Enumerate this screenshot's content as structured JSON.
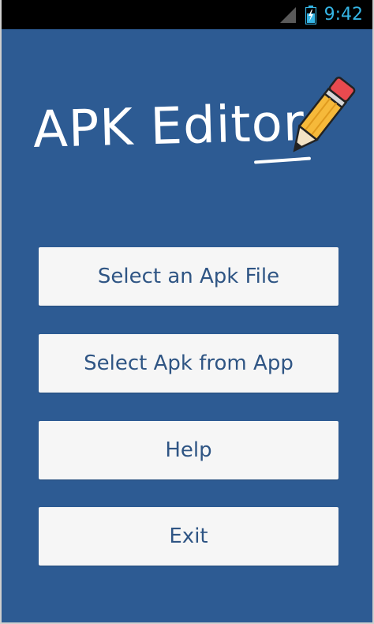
{
  "status_bar": {
    "time": "9:42",
    "icons": [
      "signal-icon",
      "battery-charging-icon"
    ],
    "clock_color": "#35b5e5"
  },
  "app": {
    "logo_text": "APK Editor",
    "background_color": "#2d5b93",
    "button_color": "#f6f6f6",
    "button_text_color": "#2f5584"
  },
  "menu": {
    "items": [
      {
        "label": "Select an Apk File"
      },
      {
        "label": "Select Apk from App"
      },
      {
        "label": "Help"
      },
      {
        "label": "Exit"
      }
    ]
  }
}
